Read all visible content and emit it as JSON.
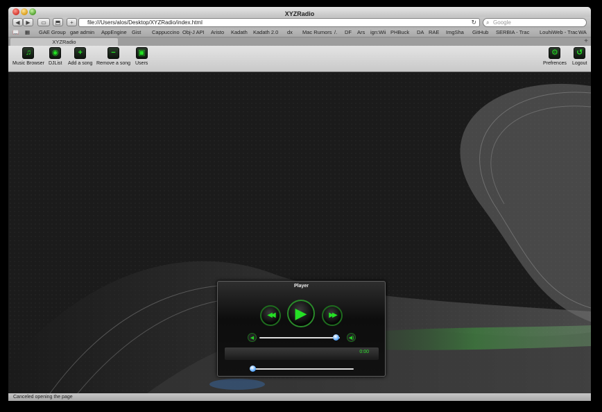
{
  "window": {
    "title": "XYZRadio"
  },
  "nav": {
    "back": "◀",
    "forward": "▶",
    "url": "file:///Users/alos/Desktop/XYZRadio/index.html",
    "search_placeholder": "Google"
  },
  "bookmarks": [
    "GAE Group",
    "gae admin",
    "AppEngine",
    "Gist",
    "Cappuccino",
    "Obj-J API",
    "Aristo",
    "Kadath",
    "Kadath 2.0",
    "dx",
    "Mac Rumors",
    "/.",
    "DF",
    "Ars",
    "ign:Wii",
    "PHBuck",
    "DA",
    "RAE",
    "ImgSha",
    "GitHub",
    "SERBIA - Trac",
    "LouhiWeb - Trac",
    "WA"
  ],
  "tab": {
    "label": "XYZRadio"
  },
  "toolbar": {
    "left": [
      {
        "label": "Music Browser",
        "icon": "music-note-icon",
        "glyph": "♫"
      },
      {
        "label": "DJList",
        "icon": "dj-list-icon",
        "glyph": "◉"
      },
      {
        "label": "Add a song",
        "icon": "add-icon",
        "glyph": "+"
      },
      {
        "label": "Remove a song",
        "icon": "remove-icon",
        "glyph": "−"
      },
      {
        "label": "Users",
        "icon": "users-icon",
        "glyph": "▣"
      }
    ],
    "right": [
      {
        "label": "Prefrences",
        "icon": "preferences-icon",
        "glyph": "⚙"
      },
      {
        "label": "Logout",
        "icon": "logout-icon",
        "glyph": "↺"
      }
    ]
  },
  "player": {
    "title": "Player",
    "rewind": "◀◀",
    "play": "▶",
    "forward": "▶▶",
    "time": "0:00",
    "volume_level": 0.95,
    "seek_level": 0.0
  },
  "status": {
    "text": "Canceled opening the page"
  },
  "colors": {
    "accent_green": "#25e025",
    "knob_blue": "#4aa0ff"
  }
}
